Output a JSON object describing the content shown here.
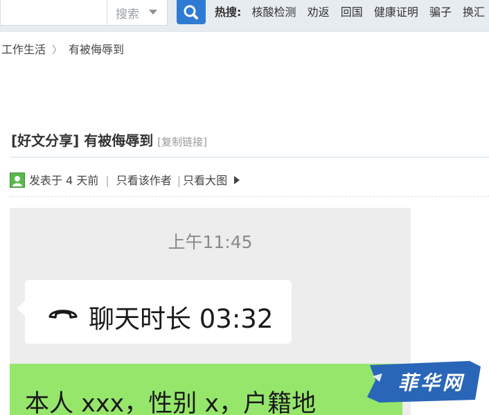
{
  "header": {
    "search_type": "搜索",
    "hot_label": "热搜:",
    "hot_items": [
      "核酸检测",
      "劝返",
      "回国",
      "健康证明",
      "骗子",
      "换汇"
    ]
  },
  "breadcrumb": {
    "parent": "工作生活",
    "current": "有被侮辱到"
  },
  "post": {
    "title": "[好文分享] 有被侮辱到",
    "copy_link": "[复制链接]",
    "posted": "发表于 4 天前",
    "only_author": "只看该作者",
    "only_large": "只看大图"
  },
  "chat": {
    "time": "上午11:45",
    "call_text": "聊天时长 03:32",
    "message": "本人 xxx，性别 x，户籍地"
  },
  "watermark": {
    "text": "菲华网"
  },
  "colors": {
    "search_button": "#2f7bd4",
    "topbar": "#e7ecf1",
    "chat_bg": "#ededed",
    "green_bubble": "#95e66b",
    "watermark_blue": "#2a66b8"
  }
}
